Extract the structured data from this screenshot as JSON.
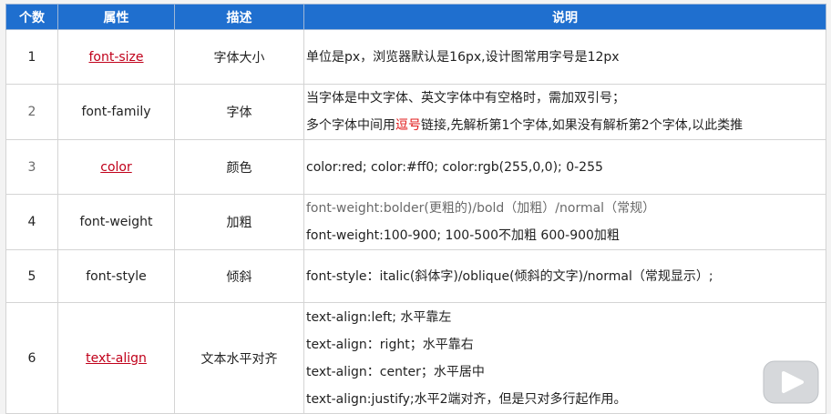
{
  "header": {
    "count": "个数",
    "attribute": "属性",
    "description": "描述",
    "explanation": "说明"
  },
  "rows": [
    {
      "num": "1",
      "prop": "font-size",
      "desc": "字体大小",
      "lines": [
        {
          "a": "单位是px，浏览器默认是16px,设计图常用字号是12px"
        }
      ]
    },
    {
      "num": "2",
      "prop": "font-family",
      "desc": "字体",
      "lines": [
        {
          "a": "当字体是中文字体、英文字体中有空格时，需加双引号；"
        },
        {
          "a": "多个字体中间用",
          "b": "逗号",
          "c": "链接,先解析第1个字体,如果没有解析第2个字体,以此类推"
        }
      ]
    },
    {
      "num": "3",
      "prop": "color",
      "desc": "颜色",
      "lines": [
        {
          "a": "color:red;  color:#ff0;  color:rgb(255,0,0);  0-255"
        }
      ]
    },
    {
      "num": "4",
      "prop": "font-weight",
      "desc": "加粗",
      "lines": [
        {
          "a": "font-weight:bolder(更粗的)/bold（加粗）/normal（常规）"
        },
        {
          "a": "font-weight:100-900; 100-500不加粗   600-900加粗"
        }
      ]
    },
    {
      "num": "5",
      "prop": "font-style",
      "desc": "倾斜",
      "lines": [
        {
          "a": "font-style：italic(斜体字)/oblique(倾斜的文字)/normal（常规显示）;"
        }
      ]
    },
    {
      "num": "6",
      "prop": "text-align",
      "desc": "文本水平对齐",
      "lines": [
        {
          "a": "text-align:left; 水平靠左"
        },
        {
          "a": "text-align：right；水平靠右"
        },
        {
          "a": "text-align：center；水平居中"
        },
        {
          "a": "text-align:justify;水平2端对齐，但是只对多行起作用。"
        }
      ]
    }
  ],
  "colors": {
    "header_bg": "#1f6fcf",
    "link_red": "#c0001a",
    "highlight_red": "#e01818"
  },
  "icons": {
    "overlay": "play-button-icon"
  }
}
